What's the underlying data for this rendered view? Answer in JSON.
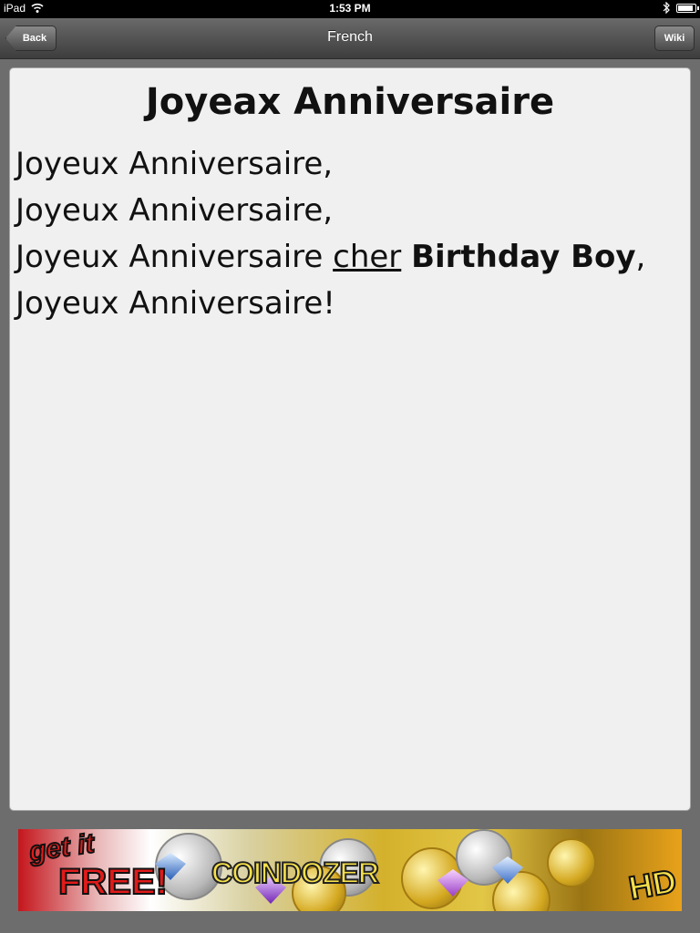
{
  "status_bar": {
    "device": "iPad",
    "time": "1:53 PM",
    "battery_level": 0.9
  },
  "nav": {
    "title": "French",
    "back_label": "Back",
    "right_label": "Wiki"
  },
  "song": {
    "title": "Joyeax Anniversaire",
    "lines": [
      "Joyeux Anniversaire,",
      "Joyeux Anniversaire,",
      {
        "prefix": "Joyeux Anniversaire ",
        "underlined": "cher",
        "bold": "Birthday Boy",
        "suffix": ","
      },
      "Joyeux Anniversaire!"
    ]
  },
  "ad": {
    "headline_1": "get it",
    "headline_2": "FREE!",
    "brand": "COINDOZER",
    "badge": "HD"
  }
}
